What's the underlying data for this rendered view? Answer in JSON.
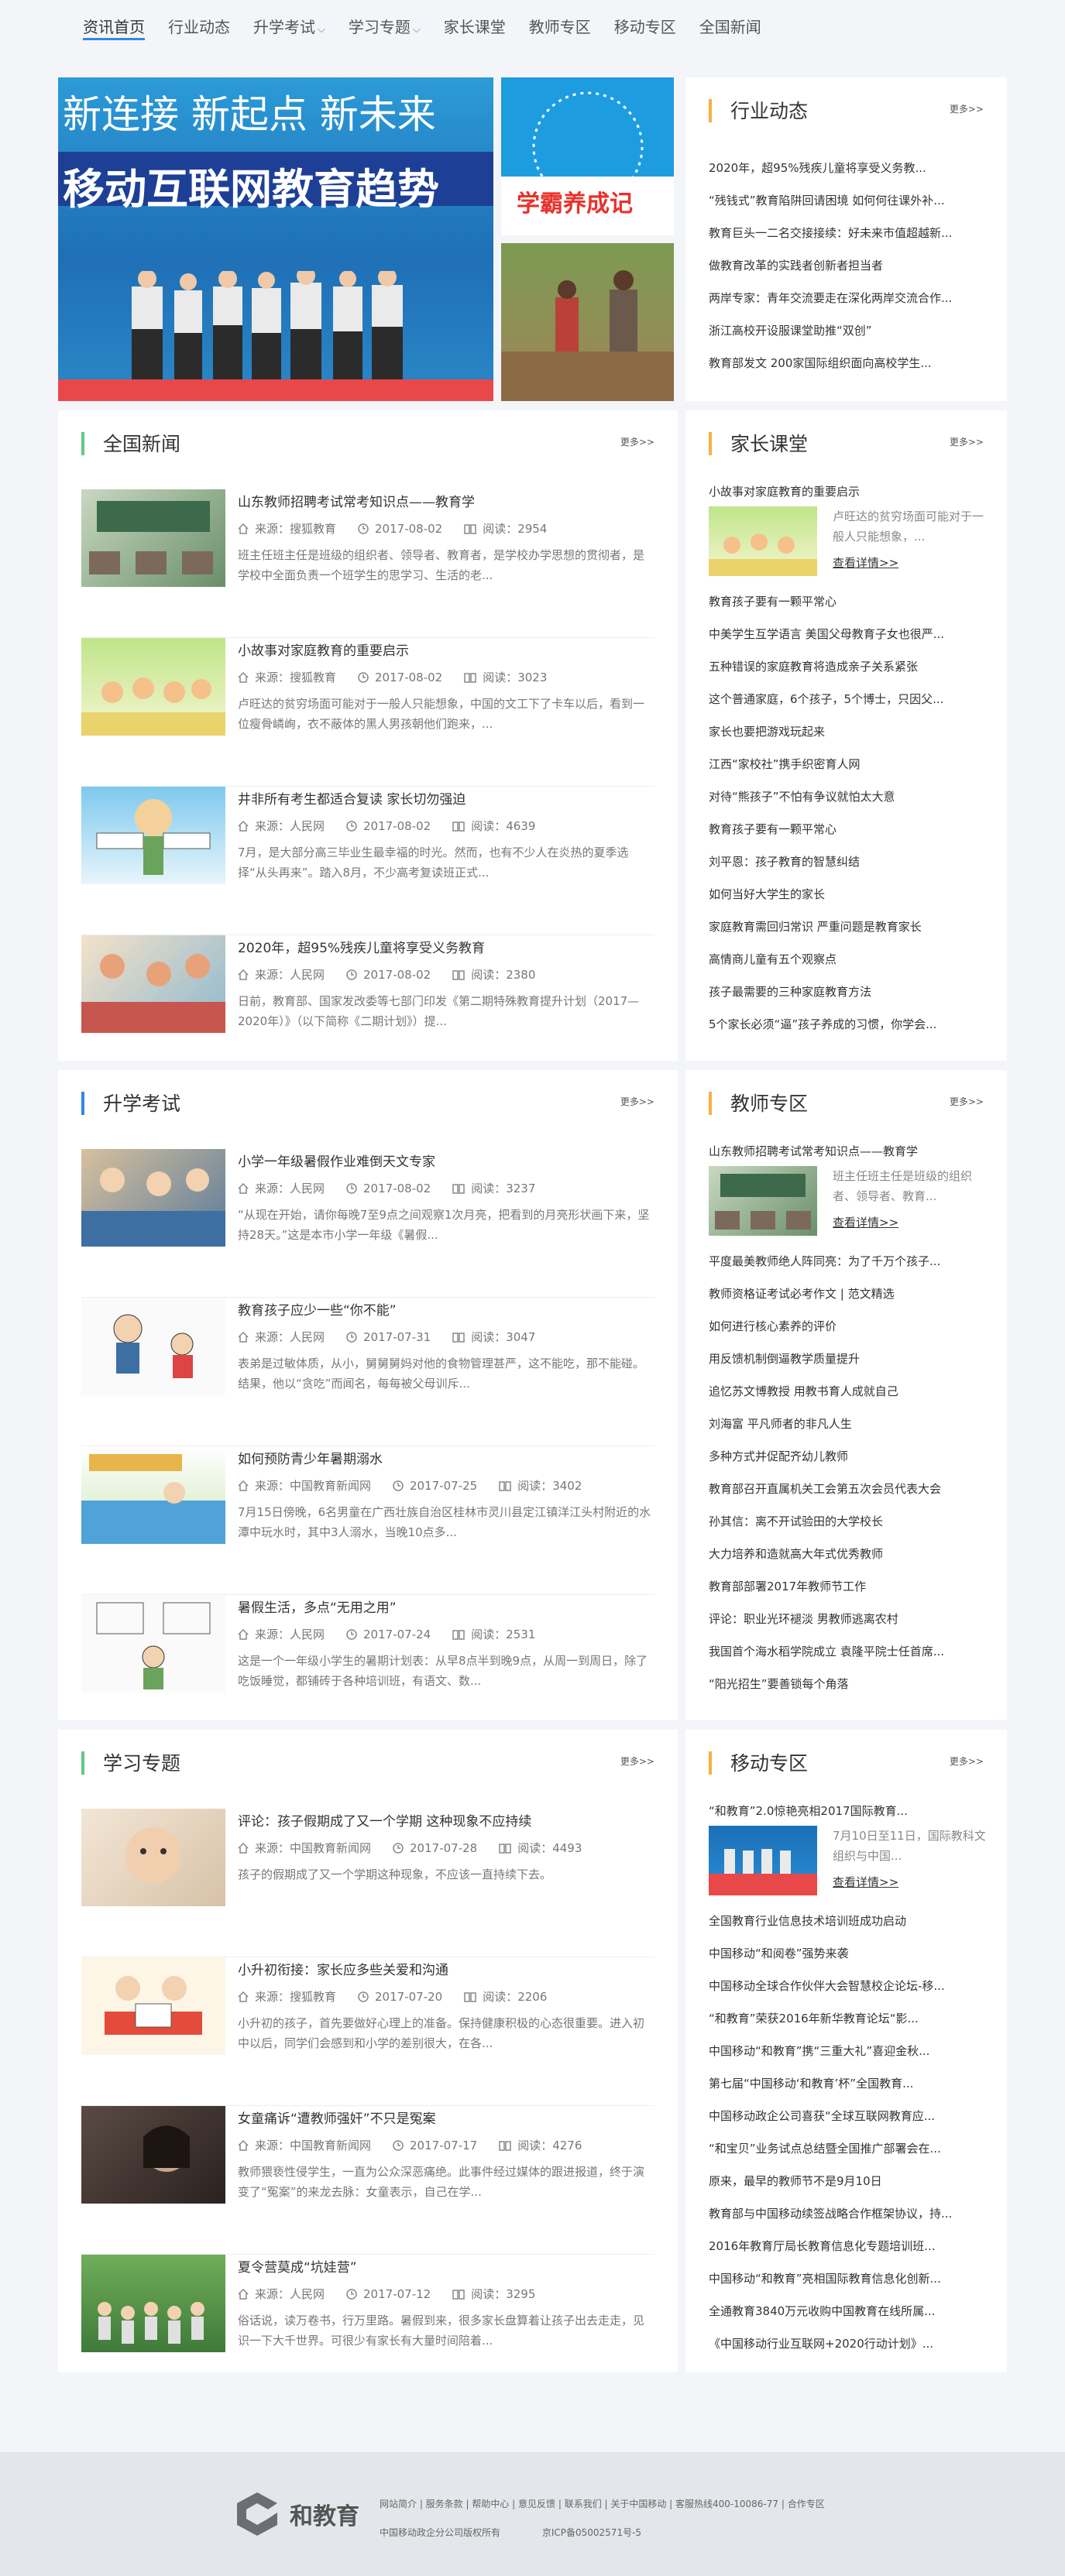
{
  "nav": {
    "items": [
      {
        "label": "资讯首页"
      },
      {
        "label": "行业动态"
      },
      {
        "label": "升学考试"
      },
      {
        "label": "学习专题"
      },
      {
        "label": "家长课堂"
      },
      {
        "label": "教师专区"
      },
      {
        "label": "移动专区"
      },
      {
        "label": "全国新闻"
      }
    ]
  },
  "banner": {
    "headline1": "新连接   新起点   新未来",
    "headline2": "移动互联网教育趋势",
    "side_badge": "学霸养成记"
  },
  "industry": {
    "title": "行业动态",
    "more": "更多>>",
    "items": [
      "2020年，超95%残疾儿童将享受义务教...",
      "“残钱式”教育陷阱回请困境 如何何往课外补...",
      "教育巨头一二名交接接续：好未来市值超越新...",
      "做教育改革的实践者创新者担当者",
      "两岸专家：青年交流要走在深化两岸交流合作...",
      "浙江高校开设服课堂助推“双创”",
      "教育部发文 200家国际组织面向高校学生..."
    ]
  },
  "national": {
    "title": "全国新闻",
    "more": "更多>>",
    "items": [
      {
        "title": "山东教师招聘考试常考知识点——教育学",
        "source": "来源：搜狐教育",
        "date": "2017-08-02",
        "reads": "阅读：2954",
        "summary": "班主任班主任是班级的组织者、领导者、教育者，是学校办学思想的贯彻者，是学校中全面负责一个班学生的思学习、生活的老..."
      },
      {
        "title": "小故事对家庭教育的重要启示",
        "source": "来源：搜狐教育",
        "date": "2017-08-02",
        "reads": "阅读：3023",
        "summary": "卢旺达的贫穷场面可能对于一般人只能想象，中国的文工下了卡车以后，看到一位瘦骨嶙峋，衣不蔽体的黑人男孩朝他们跑来，..."
      },
      {
        "title": "井非所有考生都适合复读 家长切勿强迫",
        "source": "来源：人民网",
        "date": "2017-08-02",
        "reads": "阅读：4639",
        "summary": "7月，是大部分高三毕业生最幸福的时光。然而，也有不少人在炎热的夏季选择“从头再来”。踏入8月，不少高考复读班正式..."
      },
      {
        "title": "2020年，超95%残疾儿童将享受义务教育",
        "source": "来源：人民网",
        "date": "2017-08-02",
        "reads": "阅读：2380",
        "summary": "日前，教育部、国家发改委等七部门印发《第二期特殊教育提升计划（2017—2020年）》（以下简称《二期计划》）提..."
      }
    ]
  },
  "parents": {
    "title": "家长课堂",
    "more": "更多>>",
    "feature": {
      "title": "小故事对家庭教育的重要启示",
      "desc": "卢旺达的贫穷场面可能对于一般人只能想象，...",
      "link": "查看详情>>"
    },
    "items": [
      "教育孩子要有一颗平常心",
      "中美学生互学语言 美国父母教育子女也很严...",
      "五种错误的家庭教育将造成亲子关系紧张",
      "这个普通家庭，6个孩子，5个博士，只因父...",
      "家长也要把游戏玩起来",
      "江西“家校社”携手织密育人网",
      "对待“熊孩子”不怕有争议就怕太大意",
      "教育孩子要有一颗平常心",
      "刘平恩：孩子教育的智慧纠结",
      "如何当好大学生的家长",
      "家庭教育需回归常识 严重问题是教育家长",
      "高情商儿童有五个观察点",
      "孩子最需要的三种家庭教育方法",
      "5个家长必须“逼”孩子养成的习惯，你学会..."
    ]
  },
  "exam": {
    "title": "升学考试",
    "more": "更多>>",
    "items": [
      {
        "title": "小学一年级暑假作业难倒天文专家",
        "source": "来源：人民网",
        "date": "2017-08-02",
        "reads": "阅读：3237",
        "summary": "“从现在开始，请你每晚7至9点之间观察1次月亮，把看到的月亮形状画下来，坚持28天。”这是本市小学一年级《暑假..."
      },
      {
        "title": "教育孩子应少一些“你不能”",
        "source": "来源：人民网",
        "date": "2017-07-31",
        "reads": "阅读：3047",
        "summary": "表弟是过敏体质，从小，舅舅舅妈对他的食物管理甚严，这不能吃，那不能碰。结果，他以“贪吃”而闻名，每每被父母训斥..."
      },
      {
        "title": "如何预防青少年暑期溺水",
        "source": "来源：中国教育新闻网",
        "date": "2017-07-25",
        "reads": "阅读：3402",
        "summary": "7月15日傍晚，6名男童在广西壮族自治区桂林市灵川县定江镇洋江头村附近的水潭中玩水时，其中3人溺水，当晚10点多..."
      },
      {
        "title": "暑假生活，多点“无用之用”",
        "source": "来源：人民网",
        "date": "2017-07-24",
        "reads": "阅读：2531",
        "summary": "这是一个一年级小学生的暑期计划表：从早8点半到晚9点，从周一到周日，除了吃饭睡觉，都铺砖于各种培训班，有语文、数..."
      }
    ]
  },
  "teacher": {
    "title": "教师专区",
    "more": "更多>>",
    "feature": {
      "title": "山东教师招聘考试常考知识点——教育学",
      "desc": "班主任班主任是班级的组织者、领导者、教育...",
      "link": "查看详情>>"
    },
    "items": [
      "平度最美教师绝人阵同亮：为了千万个孩子...",
      "教师资格证考试必考作文 | 范文精选",
      "如何进行核心素养的评价",
      "用反馈机制倒逼教学质量提升",
      "追忆苏文博教授 用教书育人成就自己",
      "刘海富 平凡师者的非凡人生",
      "多种方式并促配齐幼儿教师",
      "教育部召开直属机关工会第五次会员代表大会",
      "孙其信：离不开试验田的大学校长",
      "大力培养和造就高大年式优秀教师",
      "教育部部署2017年教师节工作",
      "评论：职业光环褪淡 男教师逃离农村",
      "我国首个海水稻学院成立 袁隆平院士任首席...",
      "“阳光招生”要善锁每个角落"
    ]
  },
  "topic": {
    "title": "学习专题",
    "more": "更多>>",
    "items": [
      {
        "title": "评论：孩子假期成了又一个学期 这种现象不应持续",
        "source": "来源：中国教育新闻网",
        "date": "2017-07-28",
        "reads": "阅读：4493",
        "summary": "孩子的假期成了又一个学期这种现象，不应该一直持续下去。"
      },
      {
        "title": "小升初衔接：家长应多些关爱和沟通",
        "source": "来源：搜狐教育",
        "date": "2017-07-20",
        "reads": "阅读：2206",
        "summary": "小升初的孩子，首先要做好心理上的准备。保持健康积极的心态很重要。进入初中以后，同学们会感到和小学的差别很大，在各..."
      },
      {
        "title": "女童痛诉“遭教师强奸”不只是冤案",
        "source": "来源：中国教育新闻网",
        "date": "2017-07-17",
        "reads": "阅读：4276",
        "summary": "教师猥亵性侵学生，一直为公众深恶痛绝。此事件经过媒体的跟进报道，终于演变了“冤案”的来龙去脉：女童表示，自己在学..."
      },
      {
        "title": "夏令营莫成“坑娃营”",
        "source": "来源：人民网",
        "date": "2017-07-12",
        "reads": "阅读：3295",
        "summary": "俗话说，读万卷书，行万里路。暑假到来，很多家长盘算着让孩子出去走走，见识一下大千世界。可很少有家长有大量时间陪着..."
      }
    ]
  },
  "mobile": {
    "title": "移动专区",
    "more": "更多>>",
    "feature": {
      "title": "“和教育”2.0惊艳亮相2017国际教育...",
      "desc": "7月10日至11日，国际教科文组织与中国...",
      "link": "查看详情>>"
    },
    "items": [
      "全国教育行业信息技术培训班成功启动",
      "中国移动“和阅卷”强势来袭",
      "中国移动全球合作伙伴大会智慧校企论坛-移...",
      "“和教育”荣获2016年新华教育论坛“影...",
      "中国移动“和教育”携“三重大礼”喜迎金秋...",
      "第七届“中国移动‘和教育’杯”全国教育...",
      "中国移动政企公司喜获“全球互联网教育应...",
      "“和宝贝”业务试点总结暨全国推广部署会在...",
      "原来，最早的教师节不是9月10日",
      "教育部与中国移动续签战略合作框架协议，持...",
      "2016年教育厅局长教育信息化专题培训班...",
      "中国移动“和教育”亮相国际教育信息化创新...",
      "全通教育3840万元收购中国教育在线所属...",
      "《中国移动行业互联网+2020行动计划》..."
    ]
  },
  "footer": {
    "logo_text": "和教育",
    "links": "网站简介 | 服务条款 | 帮助中心 | 意见反馈 | 联系我们 | 关于中国移动 | 客服热线400-10086-77 | 合作专区",
    "company": "中国移动政企分公司版权所有",
    "icp": "京ICP备05002571号-5"
  },
  "colors": {
    "accent_blue": "#2f8ae5",
    "accent_green": "#5fc98a",
    "accent_orange": "#f7b03f"
  }
}
